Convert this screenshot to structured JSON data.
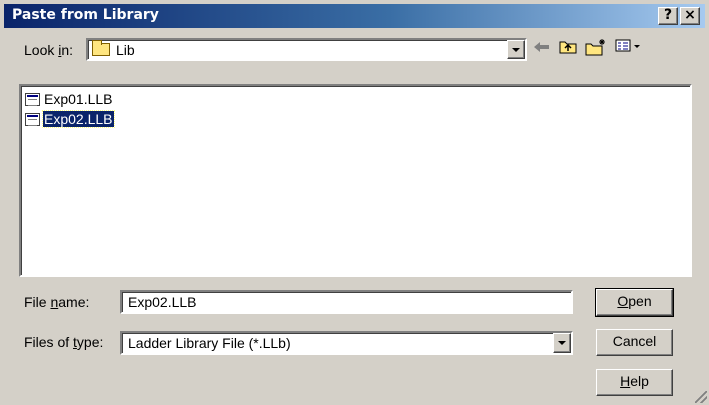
{
  "dialog": {
    "title": "Paste from Library",
    "help_label": "?",
    "close_label": "×"
  },
  "lookin": {
    "label_pre": "Look ",
    "label_key": "i",
    "label_post": "n:",
    "value": "Lib"
  },
  "toolbar": {
    "back_icon": "back-arrow-icon",
    "up_icon": "up-folder-icon",
    "new_folder_icon": "new-folder-icon",
    "views_icon": "views-menu-icon"
  },
  "files": [
    {
      "name": "Exp01.LLB",
      "selected": false
    },
    {
      "name": "Exp02.LLB",
      "selected": true
    }
  ],
  "filename": {
    "label_pre": "File ",
    "label_key": "n",
    "label_post": "ame:",
    "value": "Exp02.LLB"
  },
  "filetype": {
    "label_pre": "Files of ",
    "label_key": "t",
    "label_post": "ype:",
    "value": "Ladder Library File (*.LLb)"
  },
  "buttons": {
    "open_key": "O",
    "open_rest": "pen",
    "cancel": "Cancel",
    "help_key": "H",
    "help_rest": "elp"
  },
  "colors": {
    "title_active": "#0a246a",
    "face": "#d4d0c8",
    "selection": "#0a246a"
  }
}
